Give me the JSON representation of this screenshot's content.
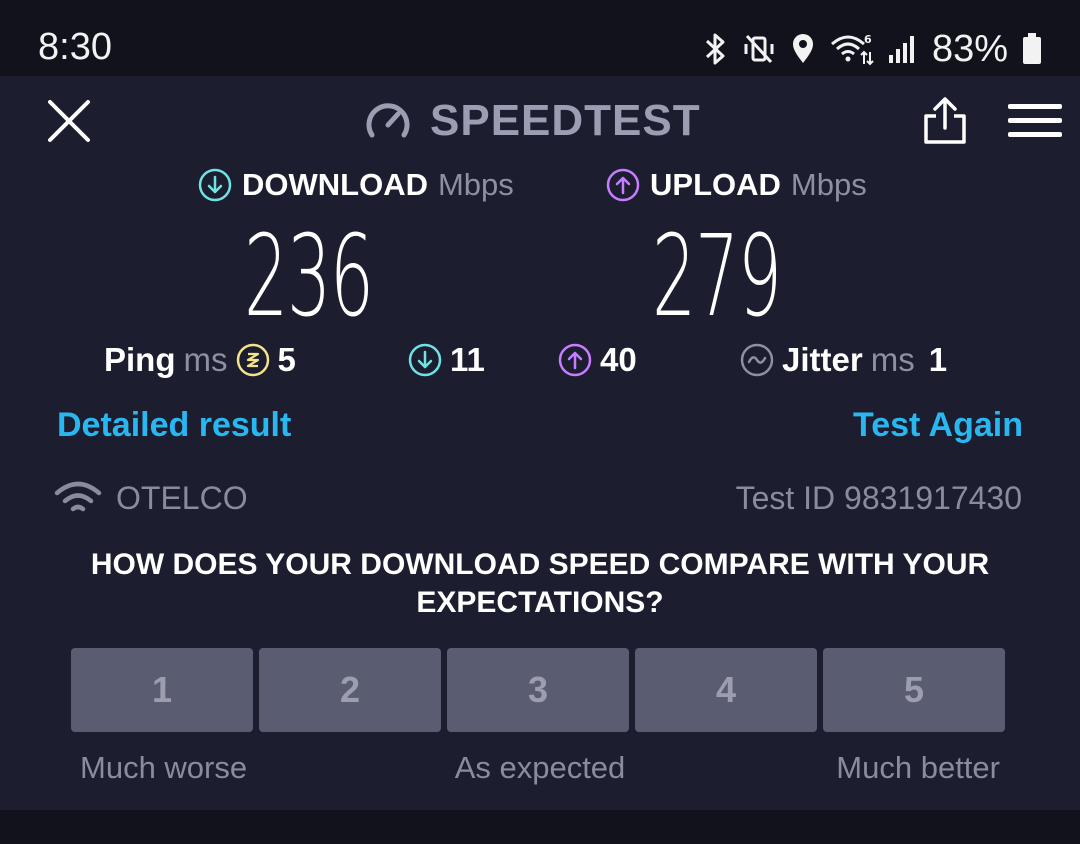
{
  "status_bar": {
    "time": "8:30",
    "battery": "83%",
    "icons": [
      "bluetooth-icon",
      "vibrate-off-icon",
      "location-icon",
      "wifi-6-icon",
      "cell-signal-icon",
      "battery-icon"
    ]
  },
  "header": {
    "title": "SPEEDTEST",
    "icons": [
      "close-icon",
      "speedometer-icon",
      "share-icon",
      "menu-icon"
    ]
  },
  "download": {
    "label": "DOWNLOAD",
    "unit": "Mbps",
    "value": "236"
  },
  "upload": {
    "label": "UPLOAD",
    "unit": "Mbps",
    "value": "279"
  },
  "ping": {
    "label": "Ping",
    "unit": "ms",
    "idle": "5",
    "download": "11",
    "upload": "40"
  },
  "jitter": {
    "label": "Jitter",
    "unit": "ms",
    "value": "1"
  },
  "links": {
    "detailed": "Detailed result",
    "again": "Test Again"
  },
  "provider": {
    "name": "OTELCO"
  },
  "test_id": "Test ID 9831917430",
  "survey": {
    "question": "HOW DOES YOUR DOWNLOAD SPEED COMPARE WITH YOUR EXPECTATIONS?",
    "options": [
      "1",
      "2",
      "3",
      "4",
      "5"
    ],
    "labels": {
      "low": "Much worse",
      "mid": "As expected",
      "high": "Much better"
    }
  },
  "colors": {
    "background": "#1c1d2f",
    "download_accent": "#6fe3e3",
    "upload_accent": "#c77dff",
    "ping_accent": "#f2e48a",
    "link": "#29b7f1"
  }
}
